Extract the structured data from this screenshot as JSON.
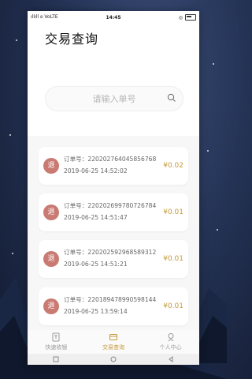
{
  "status_bar": {
    "left": "ıllıll ⍝ VoLTE",
    "time": "14:45",
    "right": "◎"
  },
  "header": {
    "title": "交易查询"
  },
  "search": {
    "placeholder": "请输入单号"
  },
  "orders": [
    {
      "badge": "退",
      "order_label": "订单号：220202764045856768",
      "datetime": "2019-06-25 14:52:02",
      "amount": "¥0.02"
    },
    {
      "badge": "退",
      "order_label": "订单号：220202699780726784",
      "datetime": "2019-06-25 14:51:47",
      "amount": "¥0.01"
    },
    {
      "badge": "退",
      "order_label": "订单号：220202592968589312",
      "datetime": "2019-06-25 14:51:21",
      "amount": "¥0.01"
    },
    {
      "badge": "退",
      "order_label": "订单号：220189478990598144",
      "datetime": "2019-06-25 13:59:14",
      "amount": "¥0.01"
    }
  ],
  "tabs": [
    {
      "label": "快速收银",
      "icon": "cashier-icon",
      "active": false
    },
    {
      "label": "交易查询",
      "icon": "wallet-icon",
      "active": true
    },
    {
      "label": "个人中心",
      "icon": "person-icon",
      "active": false
    }
  ],
  "colors": {
    "accent": "#c79a3a",
    "refund_badge": "#c97a72",
    "background_sky": "#243355"
  }
}
